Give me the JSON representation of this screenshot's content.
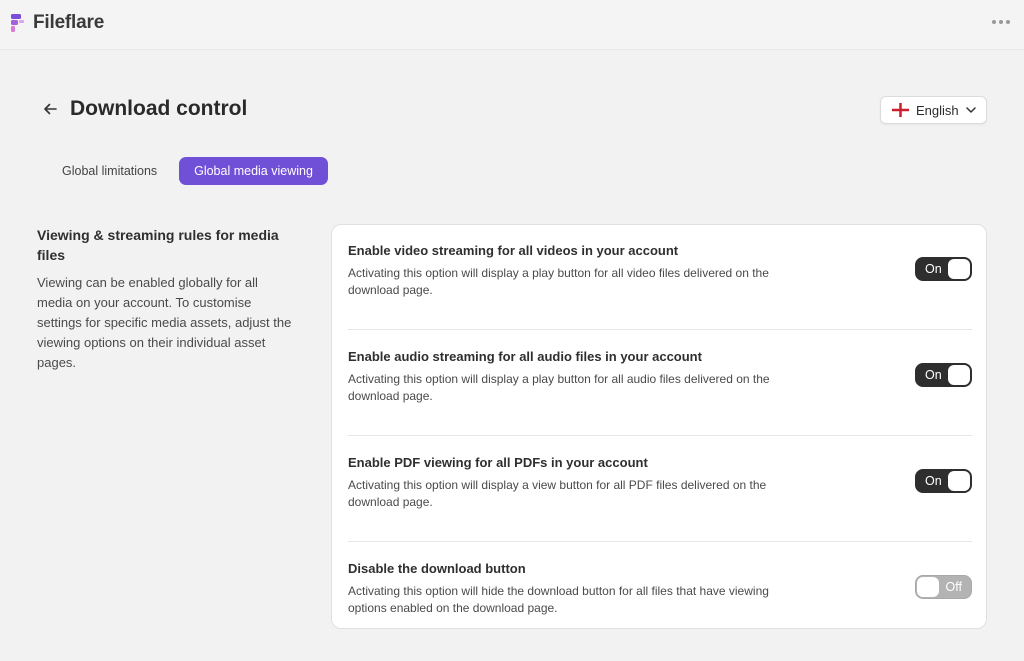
{
  "app": {
    "name": "Fileflare"
  },
  "header": {
    "title": "Download control"
  },
  "language": {
    "label": "English"
  },
  "tabs": [
    {
      "label": "Global limitations",
      "active": false
    },
    {
      "label": "Global media viewing",
      "active": true
    }
  ],
  "sidebar": {
    "heading": "Viewing & streaming rules for media files",
    "description": "Viewing can be enabled globally for all media on your account. To customise settings for specific media assets, adjust the viewing options on their individual asset pages."
  },
  "settings": [
    {
      "title": "Enable video streaming for all videos in your account",
      "description": "Activating this option will display a play button for all video files delivered on the download page.",
      "state": "On"
    },
    {
      "title": "Enable audio streaming for all audio files in your account",
      "description": "Activating this option will display a play button for all audio files delivered on the download page.",
      "state": "On"
    },
    {
      "title": "Enable PDF viewing for all PDFs in your account",
      "description": "Activating this option will display a view button for all PDF files delivered on the download page.",
      "state": "On"
    },
    {
      "title": "Disable the download button",
      "description": "Activating this option will hide the download button for all files that have viewing options enabled on the download page.",
      "state": "Off"
    }
  ],
  "colors": {
    "accent": "#7050d6",
    "toggle_on": "#2e2e2e",
    "toggle_off": "#b3b3b3",
    "flag_red": "#cc1f2f",
    "logo_purple": "#7c4ddb",
    "logo_pink": "#d77ad8"
  },
  "icons": {
    "logo": "fileflare-logo-icon",
    "more": "more-horizontal-icon",
    "back": "arrow-left-icon",
    "flag": "england-flag-icon",
    "chevron": "chevron-down-icon"
  }
}
